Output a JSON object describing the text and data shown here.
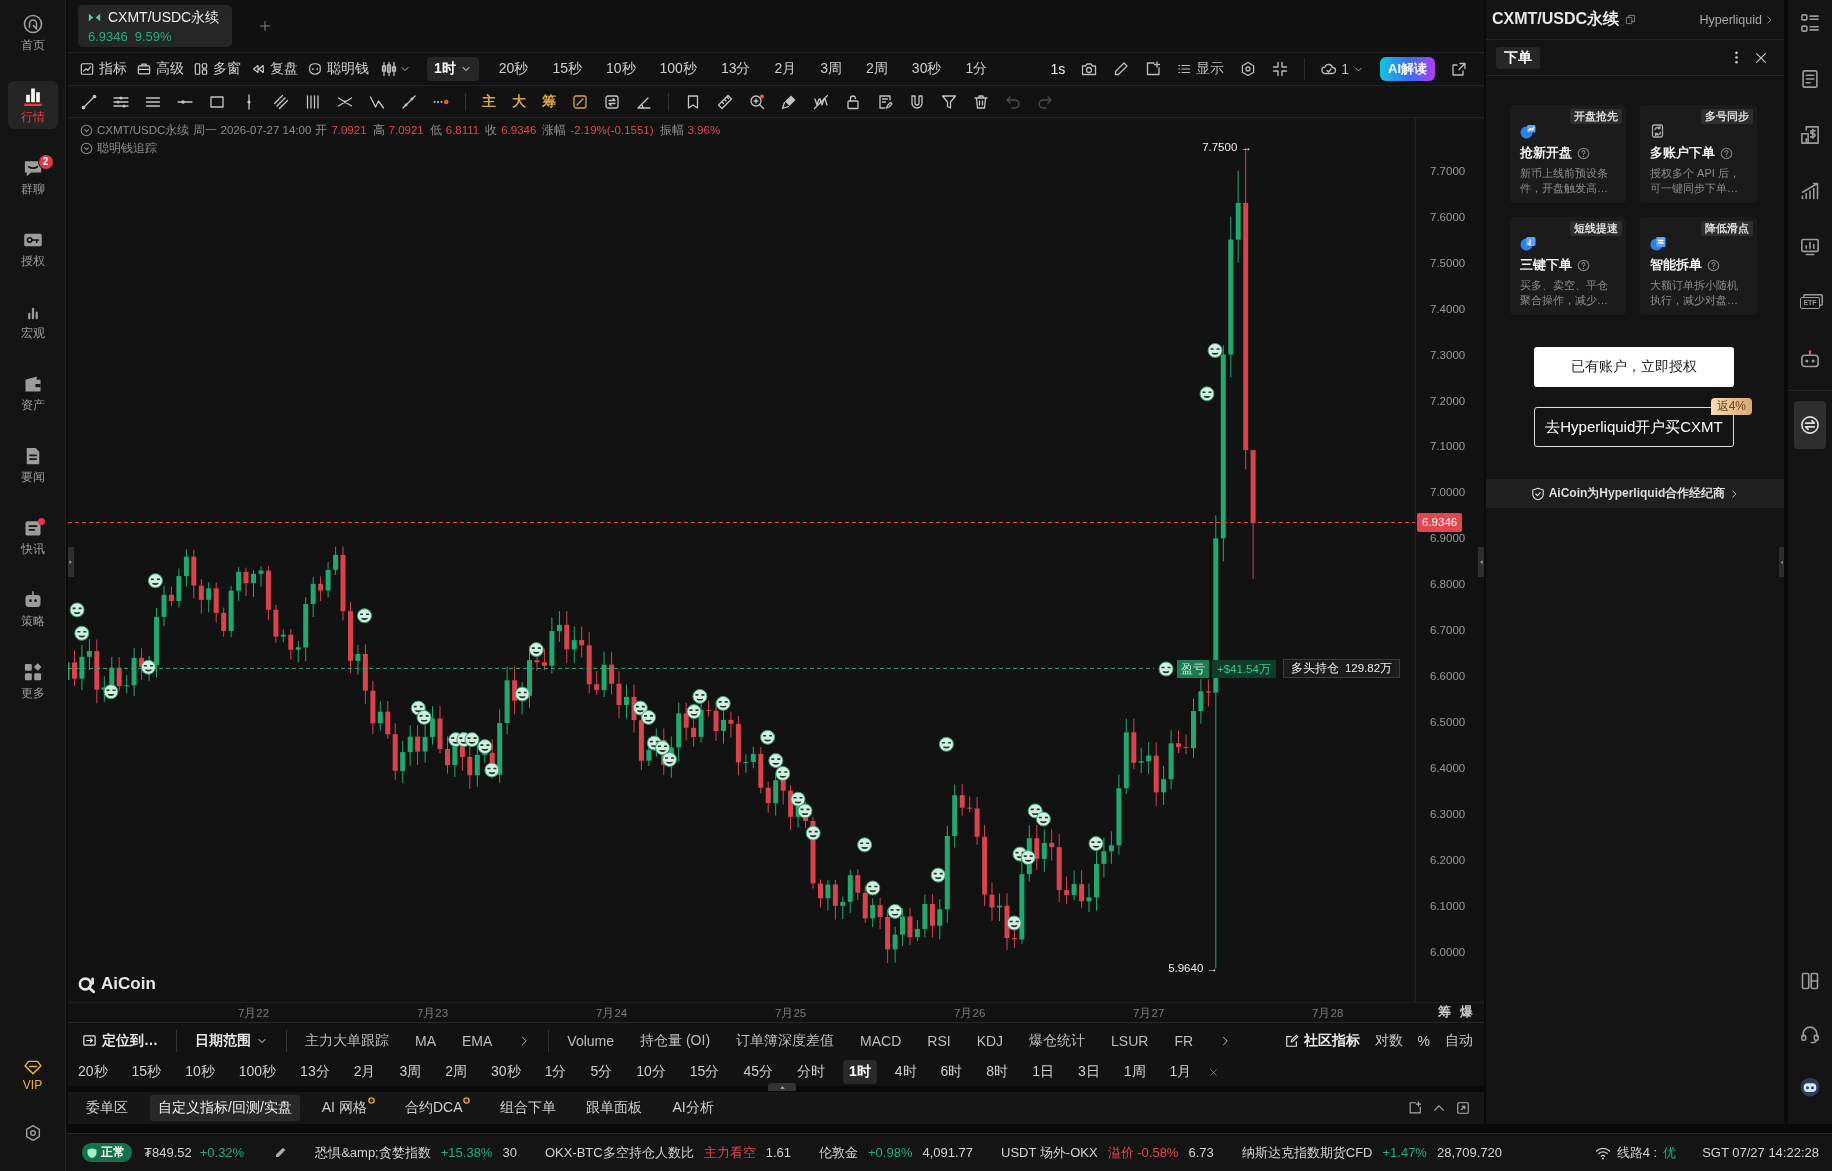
{
  "sidebar": {
    "items": [
      {
        "label": "首页",
        "selected": false,
        "dot": false
      },
      {
        "label": "行情",
        "selected": true,
        "dot": false
      },
      {
        "label": "群聊",
        "selected": false,
        "dot": false,
        "badge": "2"
      },
      {
        "label": "授权",
        "selected": false,
        "dot": false
      },
      {
        "label": "宏观",
        "selected": false,
        "dot": false
      },
      {
        "label": "资产",
        "selected": false,
        "dot": false
      },
      {
        "label": "要闻",
        "selected": false,
        "dot": false
      },
      {
        "label": "快讯",
        "selected": false,
        "dot": true
      },
      {
        "label": "策略",
        "selected": false,
        "dot": false
      },
      {
        "label": "更多",
        "selected": false,
        "dot": false
      }
    ],
    "vip": "VIP"
  },
  "chart_tabs": [
    {
      "symbol": "CXMT/USDC永续",
      "price": "6.9346",
      "change": "9.59%",
      "up": true,
      "selected": true
    }
  ],
  "toolbar": {
    "tools": [
      "指标",
      "高级",
      "多窗",
      "复盘",
      "聪明钱"
    ],
    "interval": "1时",
    "intervals": [
      {
        "label": "20秒",
        "selected": false
      },
      {
        "label": "15秒",
        "selected": false
      },
      {
        "label": "10秒",
        "selected": false
      },
      {
        "label": "100秒",
        "selected": false
      },
      {
        "label": "13分",
        "selected": false
      },
      {
        "label": "2月",
        "selected": false
      },
      {
        "label": "3周",
        "selected": false
      },
      {
        "label": "2周",
        "selected": false
      },
      {
        "label": "30秒",
        "selected": false
      },
      {
        "label": "1分",
        "selected": false
      }
    ],
    "resolution": "1s",
    "display": "显示",
    "cloud_count": "1",
    "ai_button": "AI解读"
  },
  "drawing_toolbar": {
    "text_tools": [
      {
        "label": "主",
        "on": true
      },
      {
        "label": "大",
        "on": true
      },
      {
        "label": "筹",
        "on": true
      }
    ],
    "undo_disabled": true,
    "redo_disabled": true
  },
  "legend": {
    "symbol": "CXMT/USDC永续",
    "time": "周一 2026-07-27 14:00",
    "fields": [
      {
        "label": "开",
        "value": "7.0921"
      },
      {
        "label": "高",
        "value": "7.0921"
      },
      {
        "label": "低",
        "value": "6.8111"
      },
      {
        "label": "收",
        "value": "6.9346"
      },
      {
        "label": "涨幅",
        "value": "-2.19%(-0.1551)"
      },
      {
        "label": "振幅",
        "value": "3.96%"
      }
    ],
    "up": false,
    "tracker": "聪明钱追踪"
  },
  "chart": {
    "price_ticks": [
      "7.7000",
      "7.6000",
      "7.5000",
      "7.4000",
      "7.3000",
      "7.2000",
      "7.1000",
      "7.0000",
      "6.9000",
      "6.8000",
      "6.7000",
      "6.6000",
      "6.5000",
      "6.4000",
      "6.3000",
      "6.2000",
      "6.1000",
      "6.0000"
    ],
    "date_ticks": [
      "7月22",
      "7月23",
      "7月24",
      "7月25",
      "7月26",
      "7月27",
      "7月28"
    ],
    "high_label": "7.7500 →",
    "low_label": "5.9640 →",
    "last_price": "6.9346",
    "position": {
      "pnl_label": "盈亏",
      "pnl": "+$41.54万",
      "side": "多头持仓",
      "size": "129.82万"
    },
    "watermark": "AiCoin",
    "axis_buttons": [
      "筹",
      "爆"
    ]
  },
  "indicator_bar": {
    "locate": "定位到…",
    "date_range": "日期范围",
    "main_indicators": [
      "主力大单跟踪",
      "MA",
      "EMA"
    ],
    "sub_indicators": [
      "Volume",
      "持仓量 (OI)",
      "订单簿深度差值",
      "MACD",
      "RSI",
      "KDJ",
      "爆仓统计",
      "LSUR",
      "FR"
    ],
    "community": "社区指标",
    "scales": [
      "对数",
      "%",
      "自动"
    ]
  },
  "timeframes": [
    {
      "label": "20秒",
      "selected": false
    },
    {
      "label": "15秒",
      "selected": false
    },
    {
      "label": "10秒",
      "selected": false
    },
    {
      "label": "100秒",
      "selected": false
    },
    {
      "label": "13分",
      "selected": false
    },
    {
      "label": "2月",
      "selected": false
    },
    {
      "label": "3周",
      "selected": false
    },
    {
      "label": "2周",
      "selected": false
    },
    {
      "label": "30秒",
      "selected": false
    },
    {
      "label": "1分",
      "selected": false
    },
    {
      "label": "5分",
      "selected": false
    },
    {
      "label": "10分",
      "selected": false
    },
    {
      "label": "15分",
      "selected": false
    },
    {
      "label": "45分",
      "selected": false
    },
    {
      "label": "分时",
      "selected": false
    },
    {
      "label": "1时",
      "selected": true
    },
    {
      "label": "4时",
      "selected": false
    },
    {
      "label": "6时",
      "selected": false
    },
    {
      "label": "8时",
      "selected": false
    },
    {
      "label": "1日",
      "selected": false
    },
    {
      "label": "3日",
      "selected": false
    },
    {
      "label": "1周",
      "selected": false
    },
    {
      "label": "1月",
      "selected": false
    }
  ],
  "bottom_tabs": [
    {
      "label": "委单区",
      "selected": false,
      "dot": false
    },
    {
      "label": "自定义指标/回测/实盘",
      "selected": true,
      "dot": false
    },
    {
      "label": "AI 网格",
      "selected": false,
      "dot": true
    },
    {
      "label": "合约DCA",
      "selected": false,
      "dot": true
    },
    {
      "label": "组合下单",
      "selected": false,
      "dot": false
    },
    {
      "label": "跟单面板",
      "selected": false,
      "dot": false
    },
    {
      "label": "AI分析",
      "selected": false,
      "dot": false
    }
  ],
  "order_panel": {
    "title": "CXMT/USDC永续",
    "exchange": "Hyperliquid",
    "tab": {
      "label": "下单",
      "selected": true
    },
    "features": [
      {
        "tag": "开盘抢先",
        "title": "抢新开盘",
        "description": "新币上线前预设条件，开盘触发高…"
      },
      {
        "tag": "多号同步",
        "title": "多账户下单",
        "description": "授权多个 API 后，可一键同步下单…"
      },
      {
        "tag": "短线提速",
        "title": "三键下单",
        "description": "买多、卖空、平仓聚合操作，减少…"
      },
      {
        "tag": "降低滑点",
        "title": "智能拆单",
        "description": "大额订单拆小随机执行，减少对盘…"
      }
    ],
    "authorize_button": "已有账户，立即授权",
    "signup_button": "去Hyperliquid开户买CXMT",
    "rebate_badge": "返4%",
    "partner_link": "AiCoin为Hyperliquid合作经纪商"
  },
  "right_rail": [
    {
      "selected": false
    },
    {
      "selected": false
    },
    {
      "selected": false
    },
    {
      "selected": false
    },
    {
      "selected": false
    },
    {
      "selected": false,
      "label": "ETF"
    },
    {
      "selected": false
    },
    {
      "selected": true
    },
    {
      "selected": false
    },
    {
      "selected": false
    },
    {
      "selected": false
    }
  ],
  "status_bar": {
    "health": "正常",
    "price": {
      "value": "₮849.52",
      "change": "+0.32%",
      "up": true
    },
    "tickers": [
      {
        "name": "恐惧&amp;贪婪指数",
        "change": "+15.38%",
        "value": "30",
        "up": true
      },
      {
        "name": "OKX-BTC多空持仓人数比",
        "change": "主力看空",
        "value": "1.61",
        "up": false
      },
      {
        "name": "伦敦金",
        "change": "+0.98%",
        "value": "4,091.77",
        "up": true
      },
      {
        "name": "USDT 场外-OKX",
        "change": "溢价 -0.58%",
        "value": "6.73",
        "up": false
      },
      {
        "name": "纳斯达克指数期货CFD",
        "change": "+1.47%",
        "value": "28,709.720",
        "up": true
      }
    ],
    "line": "线路4 :",
    "line_quality": "优",
    "clock": "SGT 07/27 14:22:28"
  }
}
